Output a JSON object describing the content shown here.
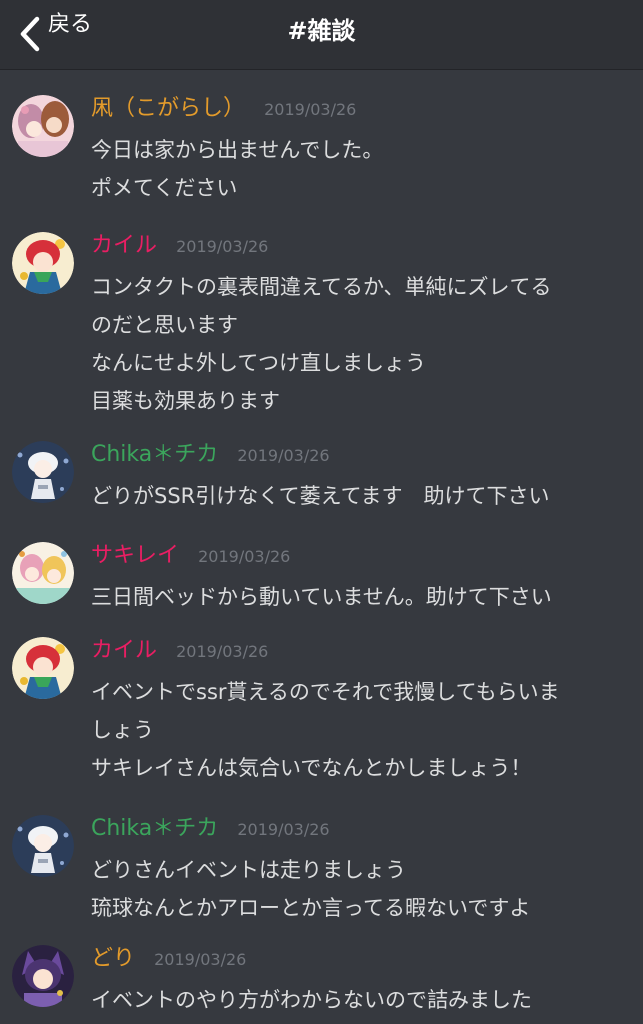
{
  "header": {
    "back_label": "戻る",
    "channel_title": "#雑談"
  },
  "colors": {
    "background": "#36393f",
    "header_background": "#2f3136",
    "message_text": "#dcddde",
    "timestamp": "#72767d",
    "author_orange": "#e39b2b",
    "author_pink": "#e91e63",
    "author_green": "#3ba55c"
  },
  "messages": [
    {
      "author": "凩（こがらし）",
      "author_color": "#e39b2b",
      "avatar_icon": "anime-girl-avatar-icon",
      "timestamp": "2019/03/26",
      "lines": [
        "今日は家から出ませんでした。",
        "ポメてください"
      ]
    },
    {
      "author": "カイル",
      "author_color": "#e91e63",
      "avatar_icon": "red-haired-character-avatar-icon",
      "timestamp": "2019/03/26",
      "lines": [
        "コンタクトの裏表間違えてるか、単純にズレてる",
        "のだと思います",
        "なんにせよ外してつけ直しましょう",
        "目薬も効果あります"
      ]
    },
    {
      "author": "Chika＊チカ",
      "author_color": "#3ba55c",
      "avatar_icon": "white-haired-character-avatar-icon",
      "timestamp": "2019/03/26",
      "lines": [
        "どりがSSR引けなくて萎えてます　助けて下さい"
      ]
    },
    {
      "author": "サキレイ",
      "author_color": "#e91e63",
      "avatar_icon": "pastel-characters-avatar-icon",
      "timestamp": "2019/03/26",
      "lines": [
        "三日間ベッドから動いていません。助けて下さい"
      ]
    },
    {
      "author": "カイル",
      "author_color": "#e91e63",
      "avatar_icon": "red-haired-character-avatar-icon",
      "timestamp": "2019/03/26",
      "lines": [
        "イベントでssr貰えるのでそれで我慢してもらいま",
        "しょう",
        "サキレイさんは気合いでなんとかしましょう！"
      ]
    },
    {
      "author": "Chika＊チカ",
      "author_color": "#3ba55c",
      "avatar_icon": "white-haired-character-avatar-icon",
      "timestamp": "2019/03/26",
      "lines": [
        "どりさんイベントは走りましょう",
        "琉球なんとかアローとか言ってる暇ないですよ"
      ]
    },
    {
      "author": "どり",
      "author_color": "#e39b2b",
      "avatar_icon": "purple-hooded-character-avatar-icon",
      "timestamp": "2019/03/26",
      "lines": [
        "イベントのやり方がわからないので詰みました"
      ]
    }
  ]
}
